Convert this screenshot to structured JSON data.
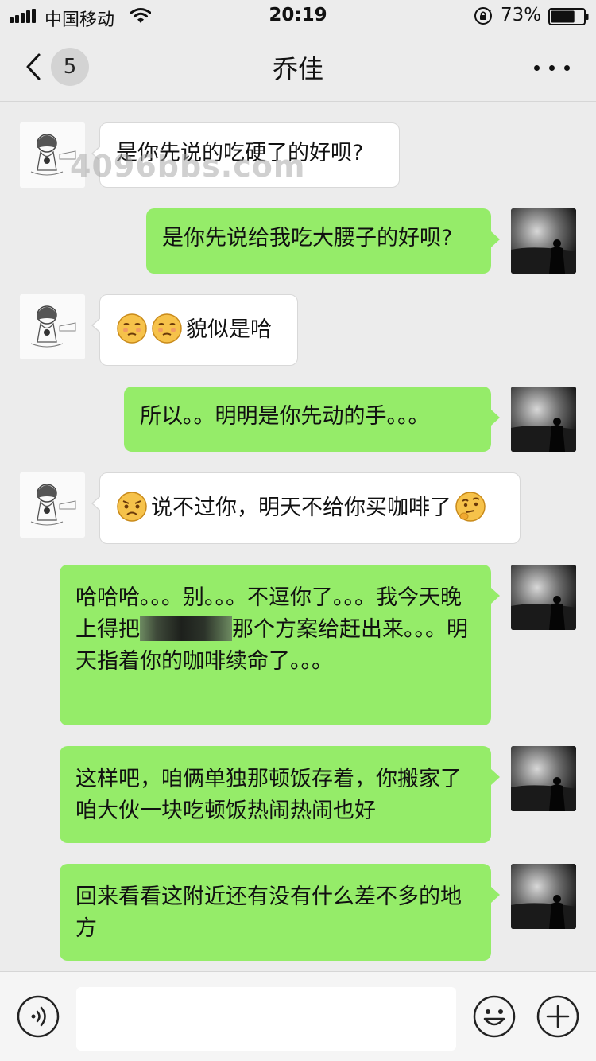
{
  "status_bar": {
    "carrier": "中国移动",
    "time": "20:19",
    "battery": "73%",
    "battery_level": 0.73
  },
  "nav": {
    "unread_count": "5",
    "title": "乔佳"
  },
  "watermark": "4096bbs.com",
  "messages": [
    {
      "from": "contact",
      "text": "是你先说的吃硬了的好呗?"
    },
    {
      "from": "me",
      "text": "是你先说给我吃大腰子的好呗?"
    },
    {
      "from": "contact",
      "emojis": [
        "smirk-face-emoji",
        "smirk-face-emoji"
      ],
      "text": "貌似是哈"
    },
    {
      "from": "me",
      "text": "所以。。明明是你先动的手。。。"
    },
    {
      "from": "contact",
      "emojis": [
        "pleading-face-emoji"
      ],
      "text": "说不过你，明天不给你买咖啡了",
      "trailing_emoji": "thinking-face-emoji"
    },
    {
      "from": "me",
      "text_part1": "哈哈哈。。。别。。。不逗你了。。。我今天晚上得把",
      "text_part2": "那个方案给赶出来。。。明天指着你的咖啡续命了。。。"
    },
    {
      "from": "me",
      "text": "这样吧，咱俩单独那顿饭存着，你搬家了咱大伙一块吃顿饭热闹热闹也好"
    },
    {
      "from": "me",
      "text": "回来看看这附近还有没有什么差不多的地方"
    }
  ],
  "colors": {
    "outgoing_bubble": "#95ec69",
    "incoming_bubble": "#ffffff",
    "background": "#ececec"
  }
}
